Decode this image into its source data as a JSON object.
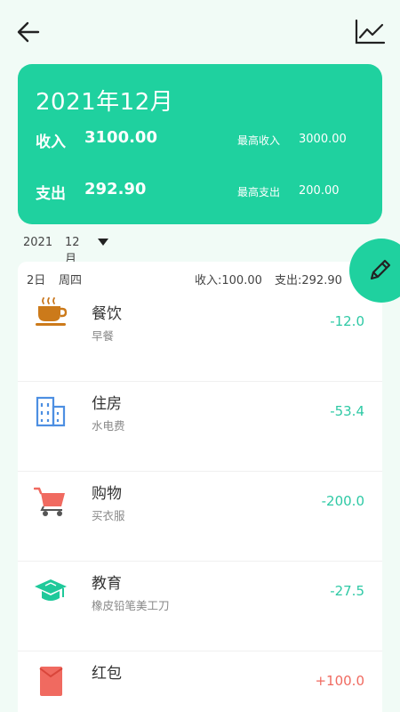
{
  "summary": {
    "title": "2021年12月",
    "income_label": "收入",
    "income_value": "3100.00",
    "max_income_label": "最高收入",
    "max_income_value": "3000.00",
    "expense_label": "支出",
    "expense_value": "292.90",
    "max_expense_label": "最高支出",
    "max_expense_value": "200.00"
  },
  "picker": {
    "year": "2021",
    "month": "12月"
  },
  "day": {
    "date": "2日",
    "weekday": "周四",
    "income": "收入:100.00",
    "expense": "支出:292.90"
  },
  "entries": [
    {
      "category": "餐饮",
      "note": "早餐",
      "amount": "-12.0",
      "icon": "coffee-cup-icon"
    },
    {
      "category": "住房",
      "note": "水电费",
      "amount": "-53.4",
      "icon": "building-icon"
    },
    {
      "category": "购物",
      "note": "买衣服",
      "amount": "-200.0",
      "icon": "shopping-cart-icon"
    },
    {
      "category": "教育",
      "note": "橡皮铅笔美工刀",
      "amount": "-27.5",
      "icon": "graduation-cap-icon"
    },
    {
      "category": "红包",
      "note": "",
      "amount": "+100.0",
      "icon": "red-envelope-icon"
    }
  ],
  "icons": {
    "back": "arrow-left-icon",
    "chart": "line-chart-icon",
    "edit": "pencil-icon",
    "caret": "caret-down-icon"
  },
  "colors": {
    "accent": "#1fd19f",
    "expense": "#2ec9a5",
    "income": "#f06a60",
    "background": "#f1fbf6"
  }
}
